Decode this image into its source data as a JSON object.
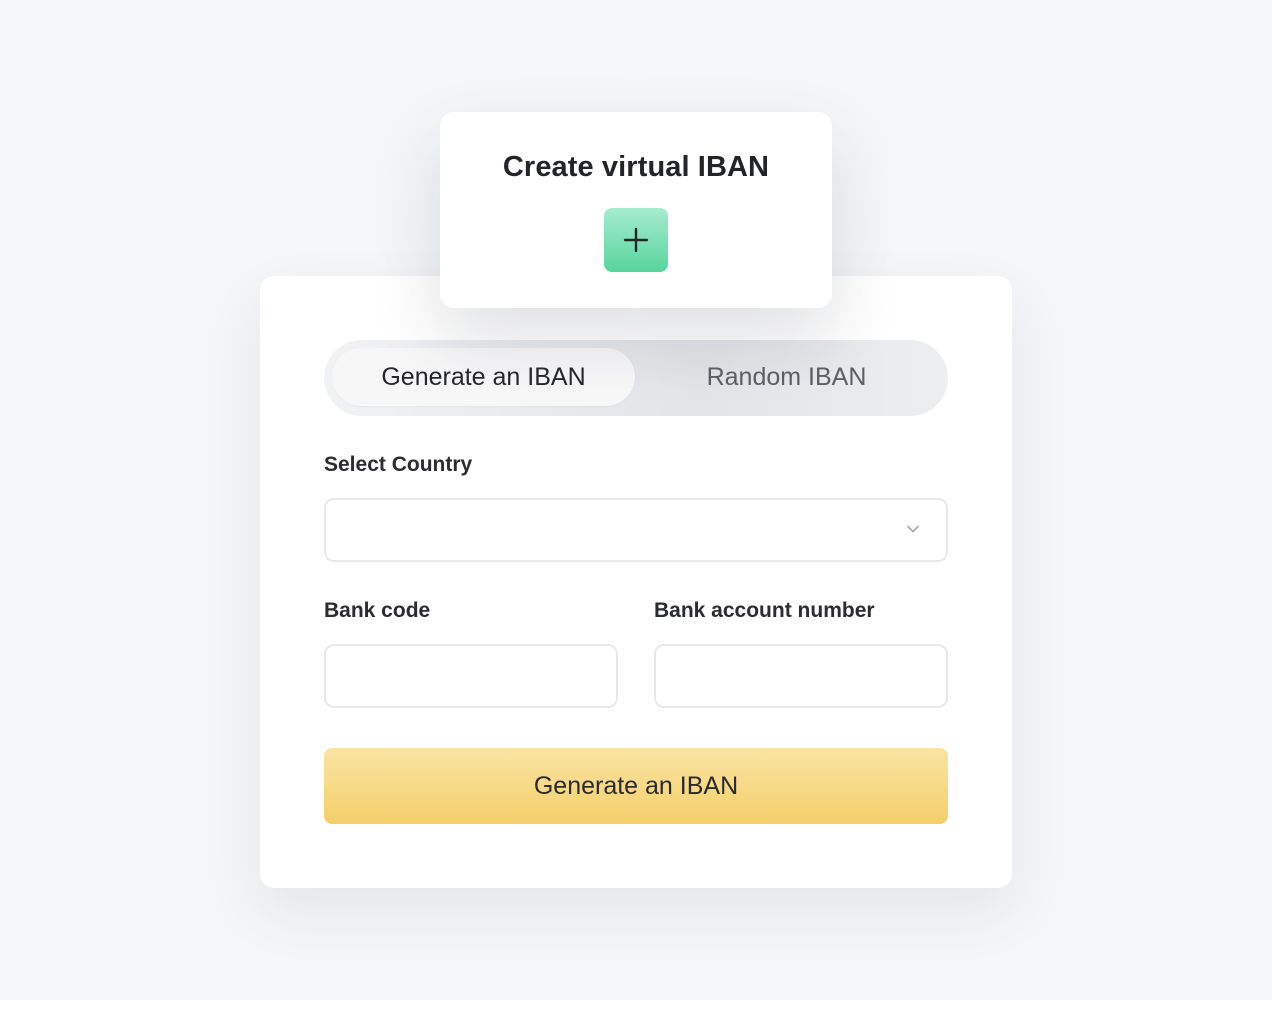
{
  "create_card": {
    "title": "Create virtual IBAN",
    "add_icon": "plus-icon"
  },
  "tabs": [
    {
      "label": "Generate an IBAN",
      "active": true
    },
    {
      "label": "Random IBAN",
      "active": false
    }
  ],
  "form": {
    "country_label": "Select Country",
    "country_value": "",
    "dropdown_icon": "chevron-down-icon",
    "bank_code_label": "Bank code",
    "bank_code_value": "",
    "account_number_label": "Bank account number",
    "account_number_value": "",
    "submit_label": "Generate an IBAN"
  },
  "colors": {
    "background": "#f5f6f8",
    "card": "#ffffff",
    "accent_green": "#58d49c",
    "accent_yellow": "#f4cf6a",
    "text_primary": "#222428",
    "text_muted": "#5b6068"
  }
}
